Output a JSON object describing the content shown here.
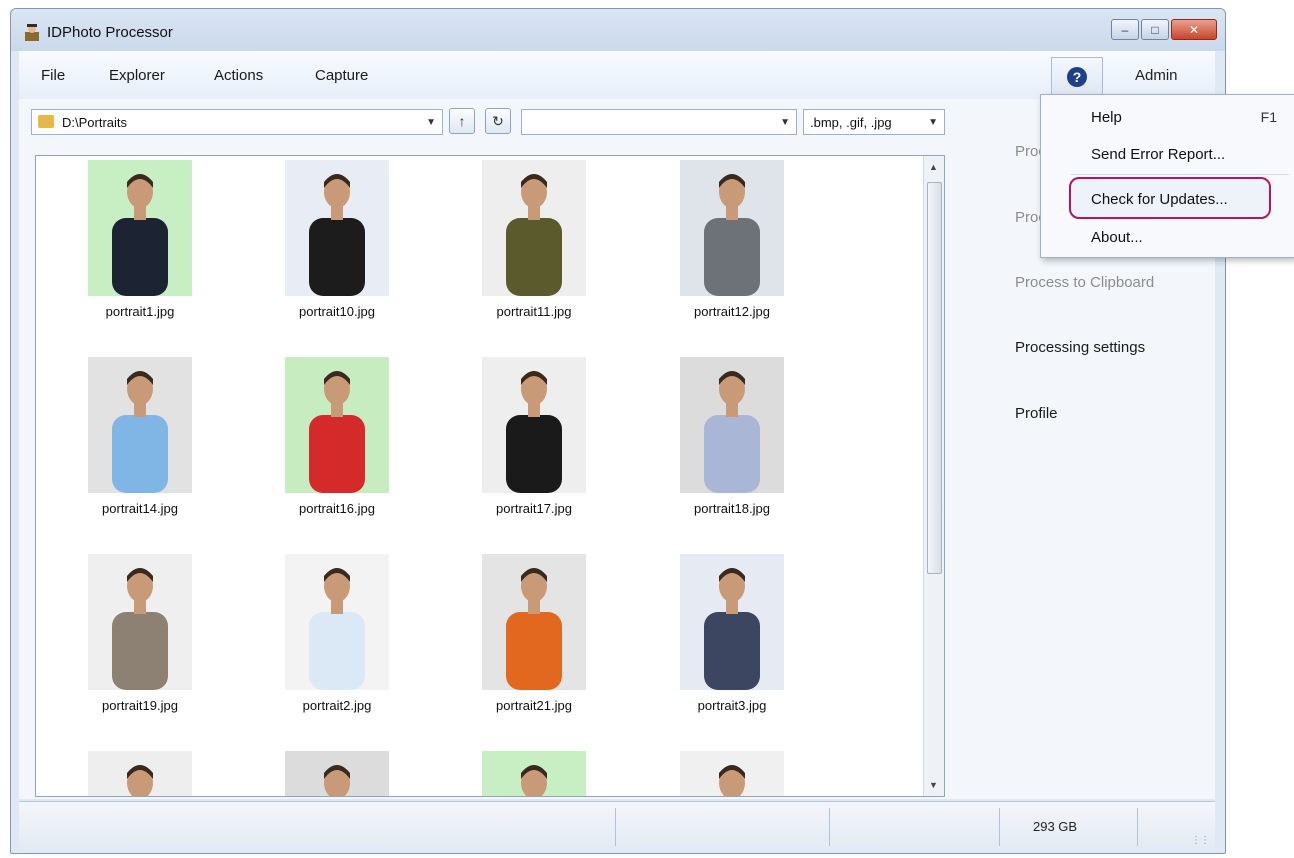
{
  "window": {
    "title": "IDPhoto Processor"
  },
  "menu": {
    "items": [
      "File",
      "Explorer",
      "Actions",
      "Capture"
    ],
    "user": "Admin"
  },
  "toolbar": {
    "path": "D:\\Portraits",
    "filter_value": "",
    "extensions": ".bmp, .gif, .jpg"
  },
  "thumbnails": [
    {
      "name": "portrait1.jpg",
      "bg": "#c8eec4",
      "shirt": "#1c2333"
    },
    {
      "name": "portrait10.jpg",
      "bg": "#e8ecf4",
      "shirt": "#1c1c1c"
    },
    {
      "name": "portrait11.jpg",
      "bg": "#eeeeee",
      "shirt": "#5b5a2c"
    },
    {
      "name": "portrait12.jpg",
      "bg": "#dfe3ea",
      "shirt": "#6d7178"
    },
    {
      "name": "portrait14.jpg",
      "bg": "#e2e2e2",
      "shirt": "#7fb6e6"
    },
    {
      "name": "portrait16.jpg",
      "bg": "#c6ecc0",
      "shirt": "#d42a2a"
    },
    {
      "name": "portrait17.jpg",
      "bg": "#eeeeee",
      "shirt": "#1a1a1a"
    },
    {
      "name": "portrait18.jpg",
      "bg": "#dcdcdc",
      "shirt": "#a9b6d6"
    },
    {
      "name": "portrait19.jpg",
      "bg": "#efefef",
      "shirt": "#8c8173"
    },
    {
      "name": "portrait2.jpg",
      "bg": "#f3f3f3",
      "shirt": "#dbe9f7"
    },
    {
      "name": "portrait21.jpg",
      "bg": "#e4e4e4",
      "shirt": "#e2681f"
    },
    {
      "name": "portrait3.jpg",
      "bg": "#e6eaf2",
      "shirt": "#3c4660"
    },
    {
      "name": "",
      "bg": "#eeeeee",
      "shirt": "#333333"
    },
    {
      "name": "",
      "bg": "#dcdcdc",
      "shirt": "#333333"
    },
    {
      "name": "",
      "bg": "#c8eec4",
      "shirt": "#333333"
    },
    {
      "name": "",
      "bg": "#f0f0f0",
      "shirt": "#333333"
    }
  ],
  "right_panel": {
    "partial_1": "Proc",
    "partial_2": "Proc",
    "clipboard": "Process to Clipboard",
    "settings": "Processing settings",
    "profile": "Profile"
  },
  "dropdown": {
    "help": "Help",
    "help_shortcut": "F1",
    "send_error": "Send Error Report...",
    "check_updates": "Check for Updates...",
    "about": "About..."
  },
  "status": {
    "disk": "293 GB"
  },
  "colors": {
    "highlight_ring": "#b0175c",
    "help_icon": "#1f3f86"
  }
}
